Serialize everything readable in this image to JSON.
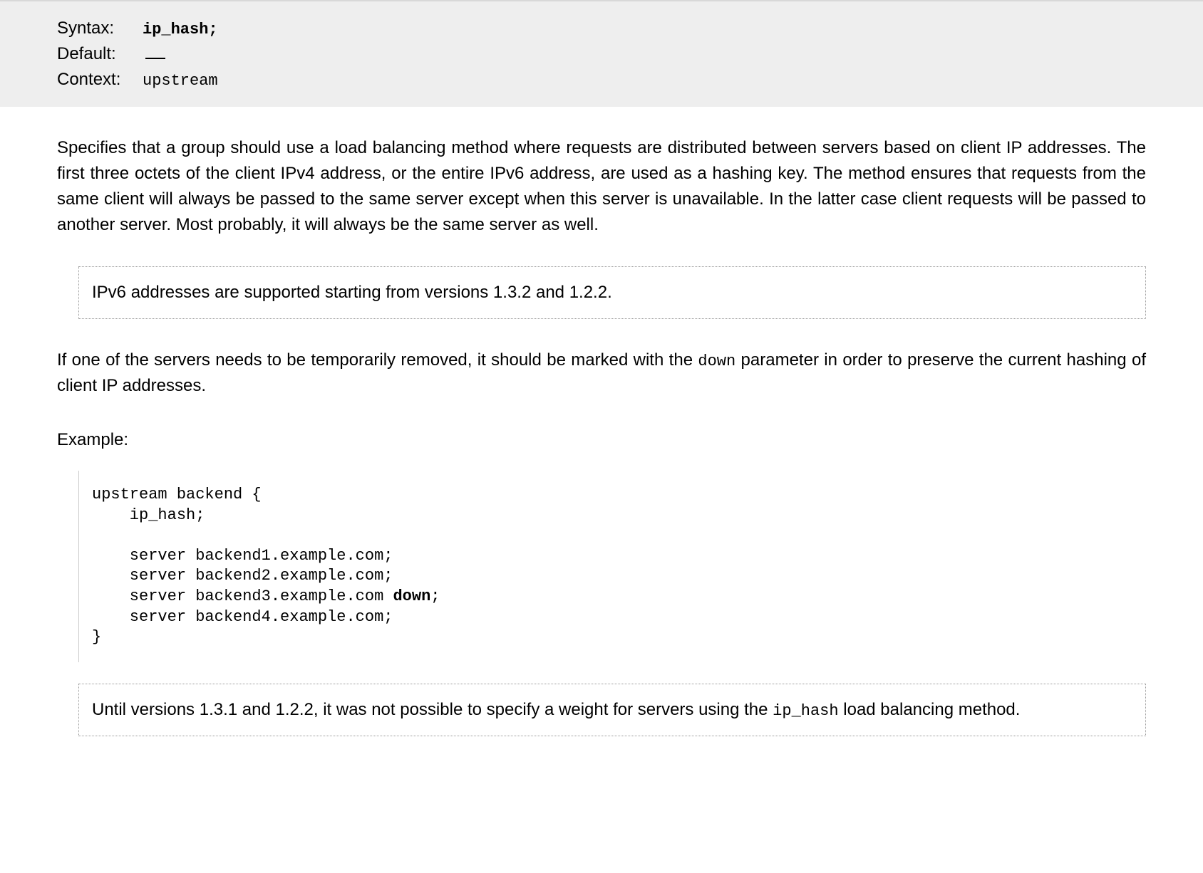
{
  "directive": {
    "syntax_label": "Syntax:",
    "syntax_value": "ip_hash;",
    "default_label": "Default:",
    "default_value": "—",
    "context_label": "Context:",
    "context_value": "upstream"
  },
  "main": {
    "p1": "Specifies that a group should use a load balancing method where requests are distributed between servers based on client IP addresses. The first three octets of the client IPv4 address, or the entire IPv6 address, are used as a hashing key. The method ensures that requests from the same client will always be passed to the same server except when this server is unavailable. In the latter case client requests will be passed to another server. Most probably, it will always be the same server as well.",
    "note1": "IPv6 addresses are supported starting from versions 1.3.2 and 1.2.2.",
    "p2_a": "If one of the servers needs to be temporarily removed, it should be marked with the ",
    "p2_code": "down",
    "p2_b": " parameter in order to preserve the current hashing of client IP addresses.",
    "example_label": "Example:",
    "example_code_1": "upstream backend {\n    ip_hash;\n\n    server backend1.example.com;\n    server backend2.example.com;\n    server backend3.example.com ",
    "example_code_bold": "down",
    "example_code_2": ";\n    server backend4.example.com;\n}",
    "note2_a": "Until versions 1.3.1 and 1.2.2, it was not possible to specify a weight for servers using the ",
    "note2_code": "ip_hash",
    "note2_b": " load balancing method."
  }
}
